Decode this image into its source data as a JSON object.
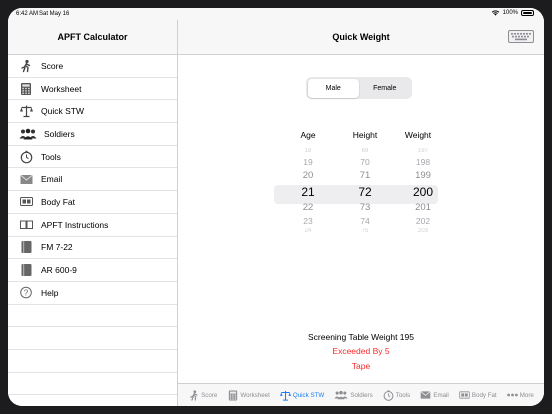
{
  "status_bar": {
    "time": "6:42 AM",
    "date": "Sat May 16",
    "battery": "100%"
  },
  "sidebar": {
    "title": "APFT Calculator",
    "items": [
      {
        "label": "Score",
        "icon": "runner-icon"
      },
      {
        "label": "Worksheet",
        "icon": "calculator-icon"
      },
      {
        "label": "Quick STW",
        "icon": "scale-icon"
      },
      {
        "label": "Soldiers",
        "icon": "soldiers-icon"
      },
      {
        "label": "Tools",
        "icon": "stopwatch-icon"
      },
      {
        "label": "Email",
        "icon": "envelope-icon"
      },
      {
        "label": "Body Fat",
        "icon": "tape-measure-icon"
      },
      {
        "label": "APFT Instructions",
        "icon": "book-open-icon"
      },
      {
        "label": "FM 7-22",
        "icon": "book-icon"
      },
      {
        "label": "AR 600-9",
        "icon": "book-icon"
      },
      {
        "label": "Help",
        "icon": "question-icon"
      }
    ]
  },
  "main": {
    "title": "Quick Weight",
    "gender": {
      "options": [
        "Male",
        "Female"
      ],
      "selected": "Male"
    },
    "columns": [
      "Age",
      "Height",
      "Weight"
    ],
    "pickers": {
      "age": [
        "18",
        "19",
        "20",
        "21",
        "22",
        "23",
        "24"
      ],
      "height": [
        "69",
        "70",
        "71",
        "72",
        "73",
        "74",
        "75"
      ],
      "weight": [
        "197",
        "198",
        "199",
        "200",
        "201",
        "202",
        "203"
      ]
    },
    "result": {
      "screening": "Screening Table Weight 195",
      "exceeded": "Exceeded By 5",
      "action": "Tape"
    }
  },
  "tabbar": {
    "tabs": [
      {
        "label": "Score",
        "icon": "runner-icon"
      },
      {
        "label": "Worksheet",
        "icon": "calculator-icon"
      },
      {
        "label": "Quick STW",
        "icon": "scale-icon",
        "active": true
      },
      {
        "label": "Soldiers",
        "icon": "soldiers-icon"
      },
      {
        "label": "Tools",
        "icon": "stopwatch-icon"
      },
      {
        "label": "Email",
        "icon": "envelope-icon"
      },
      {
        "label": "Body Fat",
        "icon": "tape-measure-icon"
      },
      {
        "label": "More",
        "icon": "more-icon"
      }
    ]
  },
  "colors": {
    "accent": "#1a7ef7",
    "alert": "#ff2a2a",
    "separator": "#d0d0d4",
    "bar_bg": "#f7f7f7"
  }
}
